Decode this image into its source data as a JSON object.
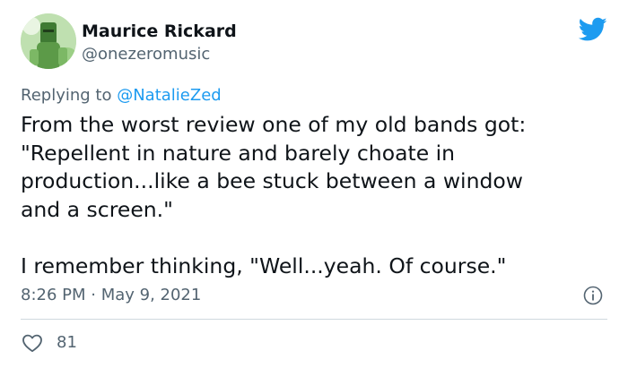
{
  "author": {
    "display_name": "Maurice Rickard",
    "handle": "@onezeromusic",
    "avatar_icon": "avatar-photo"
  },
  "brand": {
    "icon": "twitter-bird-icon",
    "color": "#1d9bf0"
  },
  "reply": {
    "prefix": "Replying to ",
    "mention": "@NatalieZed"
  },
  "tweet": {
    "lines": [
      "From the worst review one of my old bands got:",
      "\"Repellent in nature and barely choate in",
      "production...like a bee stuck between a window",
      "and a screen.\"",
      "I remember thinking, \"Well...yeah. Of course.\""
    ]
  },
  "meta": {
    "timestamp": "8:26 PM · May 9, 2021",
    "info_icon": "info-icon"
  },
  "engagement": {
    "like_icon": "heart-icon",
    "like_count": "81"
  },
  "colors": {
    "text_primary": "#0f1419",
    "text_secondary": "#536471",
    "link": "#1d9bf0",
    "divider": "#cfd9de"
  }
}
